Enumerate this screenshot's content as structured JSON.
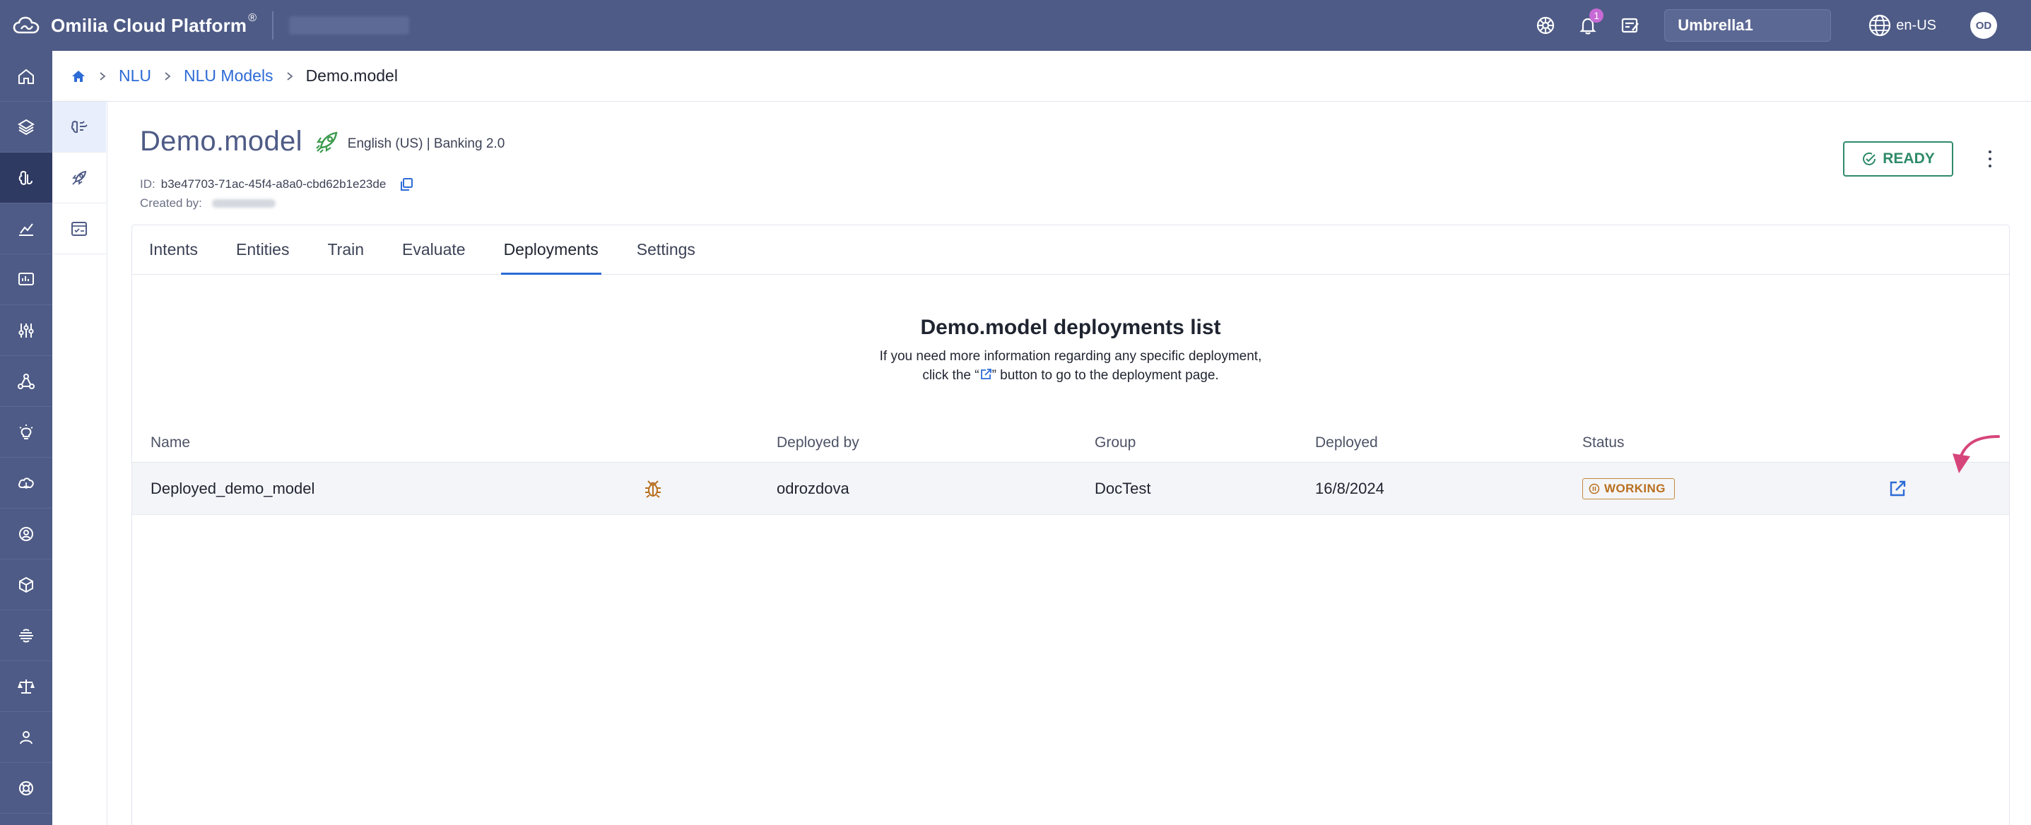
{
  "app": {
    "brand": "Omilia Cloud Platform",
    "brand_mark": "®",
    "notification_count": "1",
    "tenant": "Umbrella1",
    "language": "en-US",
    "user_initials": "OD"
  },
  "breadcrumb": {
    "items": [
      "NLU",
      "NLU Models"
    ],
    "current": "Demo.model"
  },
  "model": {
    "name": "Demo.model",
    "meta": "English (US) | Banking 2.0",
    "id_label": "ID:",
    "id_value": "b3e47703-71ac-45f4-a8a0-cbd62b1e23de",
    "created_label": "Created by:",
    "status_button": "READY"
  },
  "tabs": [
    "Intents",
    "Entities",
    "Train",
    "Evaluate",
    "Deployments",
    "Settings"
  ],
  "active_tab": "Deployments",
  "deployments": {
    "title": "Demo.model deployments list",
    "desc_line1": "If you need more information regarding any specific deployment,",
    "desc_line2_pre": "click the “",
    "desc_line2_post": "” button to go to the deployment page.",
    "columns": [
      "Name",
      "Deployed by",
      "Group",
      "Deployed",
      "Status"
    ],
    "rows": [
      {
        "name": "Deployed_demo_model",
        "deployed_by": "odrozdova",
        "group": "DocTest",
        "deployed": "16/8/2024",
        "status": "WORKING"
      }
    ]
  },
  "colors": {
    "header": "#4e5b86",
    "accent": "#2d6bd6",
    "ready": "#2e8a69",
    "working": "#b86f1e",
    "annotation": "#d6457a"
  },
  "icons": {
    "topbar": [
      "settings-wheel-icon",
      "bell-icon",
      "notes-icon",
      "globe-icon"
    ],
    "leftnav": [
      "home-icon",
      "layers-icon",
      "nlu-icon",
      "analytics-icon",
      "reports-icon",
      "sliders-icon",
      "network-icon",
      "bulb-icon",
      "cloud-icon",
      "user-settings-icon",
      "cube-icon",
      "brain-icon",
      "scales-icon",
      "person-icon",
      "support-icon"
    ],
    "subnav": [
      "model-icon",
      "rocket-icon",
      "checklist-icon"
    ]
  }
}
